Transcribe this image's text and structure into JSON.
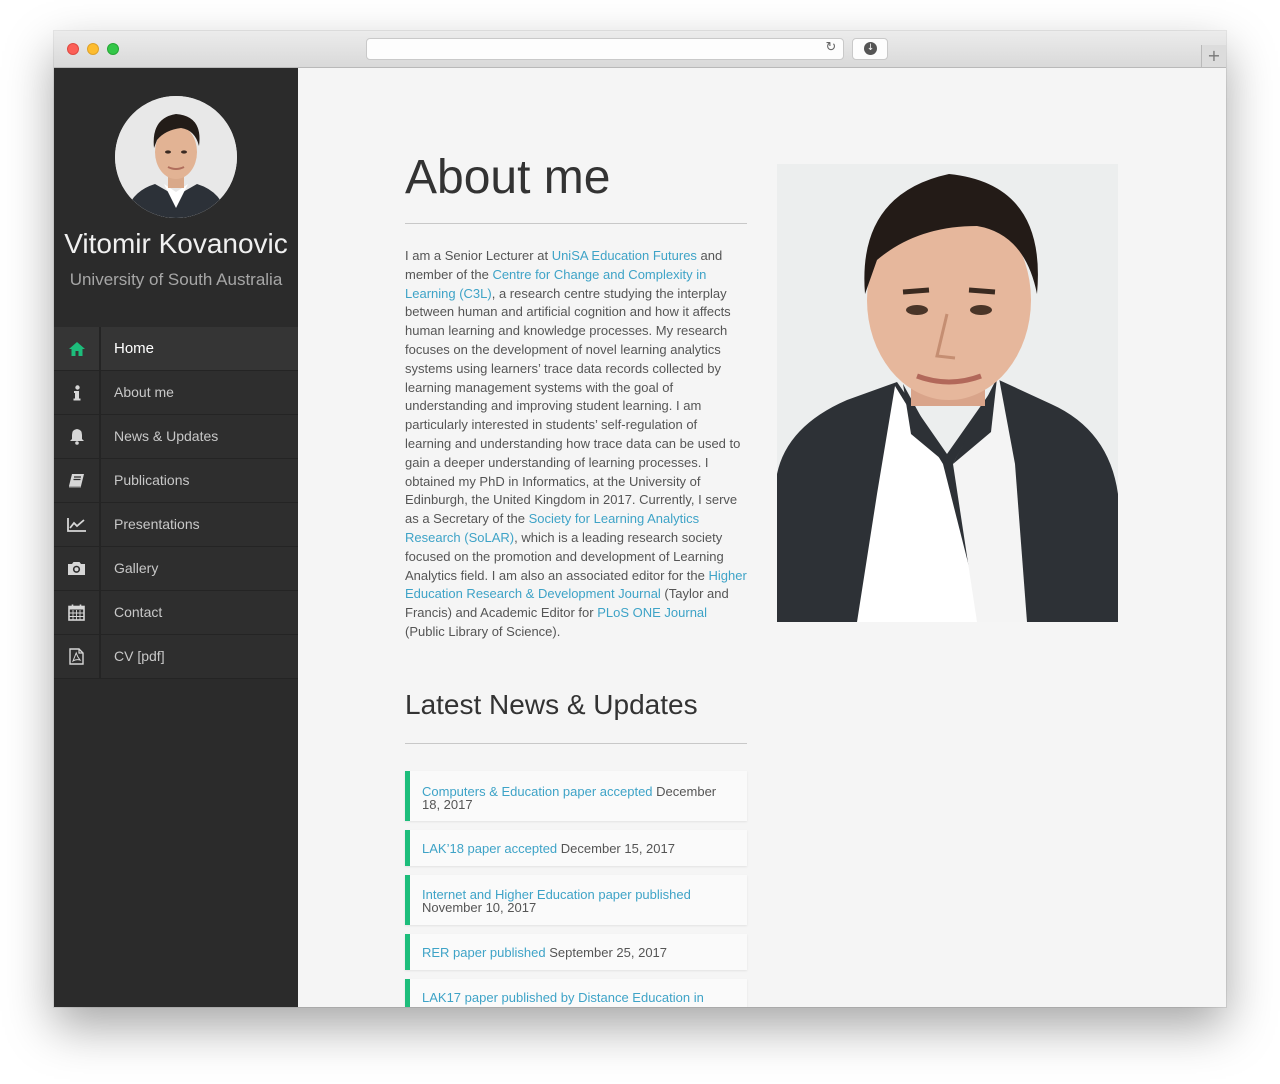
{
  "browser": {
    "reload_glyph": "↻",
    "download_glyph": "↓",
    "new_tab_glyph": "+"
  },
  "profile": {
    "name": "Vitomir Kovanovic",
    "affiliation": "University of South Australia"
  },
  "nav": [
    {
      "label": "Home",
      "icon": "home-icon",
      "active": true
    },
    {
      "label": "About me",
      "icon": "info-icon",
      "active": false
    },
    {
      "label": "News & Updates",
      "icon": "bell-icon",
      "active": false
    },
    {
      "label": "Publications",
      "icon": "book-icon",
      "active": false
    },
    {
      "label": "Presentations",
      "icon": "line-chart-icon",
      "active": false
    },
    {
      "label": "Gallery",
      "icon": "camera-icon",
      "active": false
    },
    {
      "label": "Contact",
      "icon": "calendar-icon",
      "active": false
    },
    {
      "label": "CV [pdf]",
      "icon": "pdf-file-icon",
      "active": false
    }
  ],
  "about": {
    "heading": "About me",
    "t1": "I am a Senior Lecturer at ",
    "l1": "UniSA Education Futures",
    "t2": " and member of the ",
    "l2": "Centre for Change and Complexity in Learning (C3L)",
    "t3": ", a research centre studying the interplay between human and artificial cognition and how it affects human learning and knowledge processes. My research focuses on the development of novel learning analytics systems using learners’ trace data records collected by learning management systems with the goal of understanding and improving student learning. I am particularly interested in students’ self-regulation of learning and understanding how trace data can be used to gain a deeper understanding of learning processes. I obtained my PhD in Informatics, at the University of Edinburgh, the United Kingdom in 2017. Currently, I serve as a Secretary of the ",
    "l3": "Society for Learning Analytics Research (SoLAR)",
    "t4": ", which is a leading research society focused on the promotion and development of Learning Analytics field. I am also an associated editor for the ",
    "l4": "Higher Education Research & Development Journal",
    "t5": " (Taylor and Francis) and Academic Editor for ",
    "l5": "PLoS ONE Journal",
    "t6": " (Public Library of Science)."
  },
  "news": {
    "heading": "Latest News & Updates",
    "items": [
      {
        "title": "Computers & Education paper accepted",
        "date": "December 18, 2017"
      },
      {
        "title": "LAK’18 paper accepted",
        "date": "December 15, 2017"
      },
      {
        "title": "Internet and Higher Education paper published",
        "date": "November 10, 2017"
      },
      {
        "title": "RER paper published",
        "date": "September 25, 2017"
      },
      {
        "title": "LAK17 paper published by Distance Education in",
        "date": ""
      }
    ]
  },
  "colors": {
    "accent": "#1dbd7b",
    "link": "#3ea3c7",
    "sidebar": "#2b2b2b"
  }
}
